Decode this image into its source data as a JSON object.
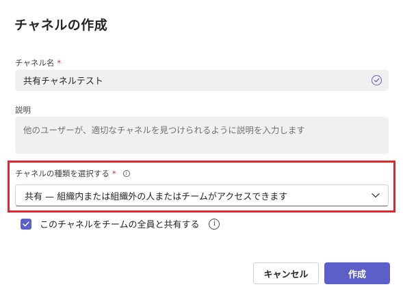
{
  "dialog": {
    "title": "チャネルの作成"
  },
  "channel_name": {
    "label": "チャネル名",
    "required_mark": "*",
    "value": "共有チャネルテスト",
    "status_icon": "check-circle-icon"
  },
  "description": {
    "label": "説明",
    "placeholder": "他のユーザーが、適切なチャネルを見つけられるように説明を入力します"
  },
  "channel_type": {
    "label": "チャネルの種類を選択する",
    "required_mark": "*",
    "info_icon": "info-icon",
    "selected": "共有 — 組織内または組織外の人またはチームがアクセスできます",
    "dropdown_icon": "chevron-down-icon"
  },
  "share_option": {
    "checked": true,
    "label": "このチャネルをチームの全員と共有する",
    "info_icon": "info-icon"
  },
  "buttons": {
    "cancel": "キャンセル",
    "create": "作成"
  },
  "colors": {
    "accent": "#5b5fc7",
    "required": "#c4314b",
    "highlight": "#e3262b",
    "field_bg": "#f0f0f0"
  }
}
